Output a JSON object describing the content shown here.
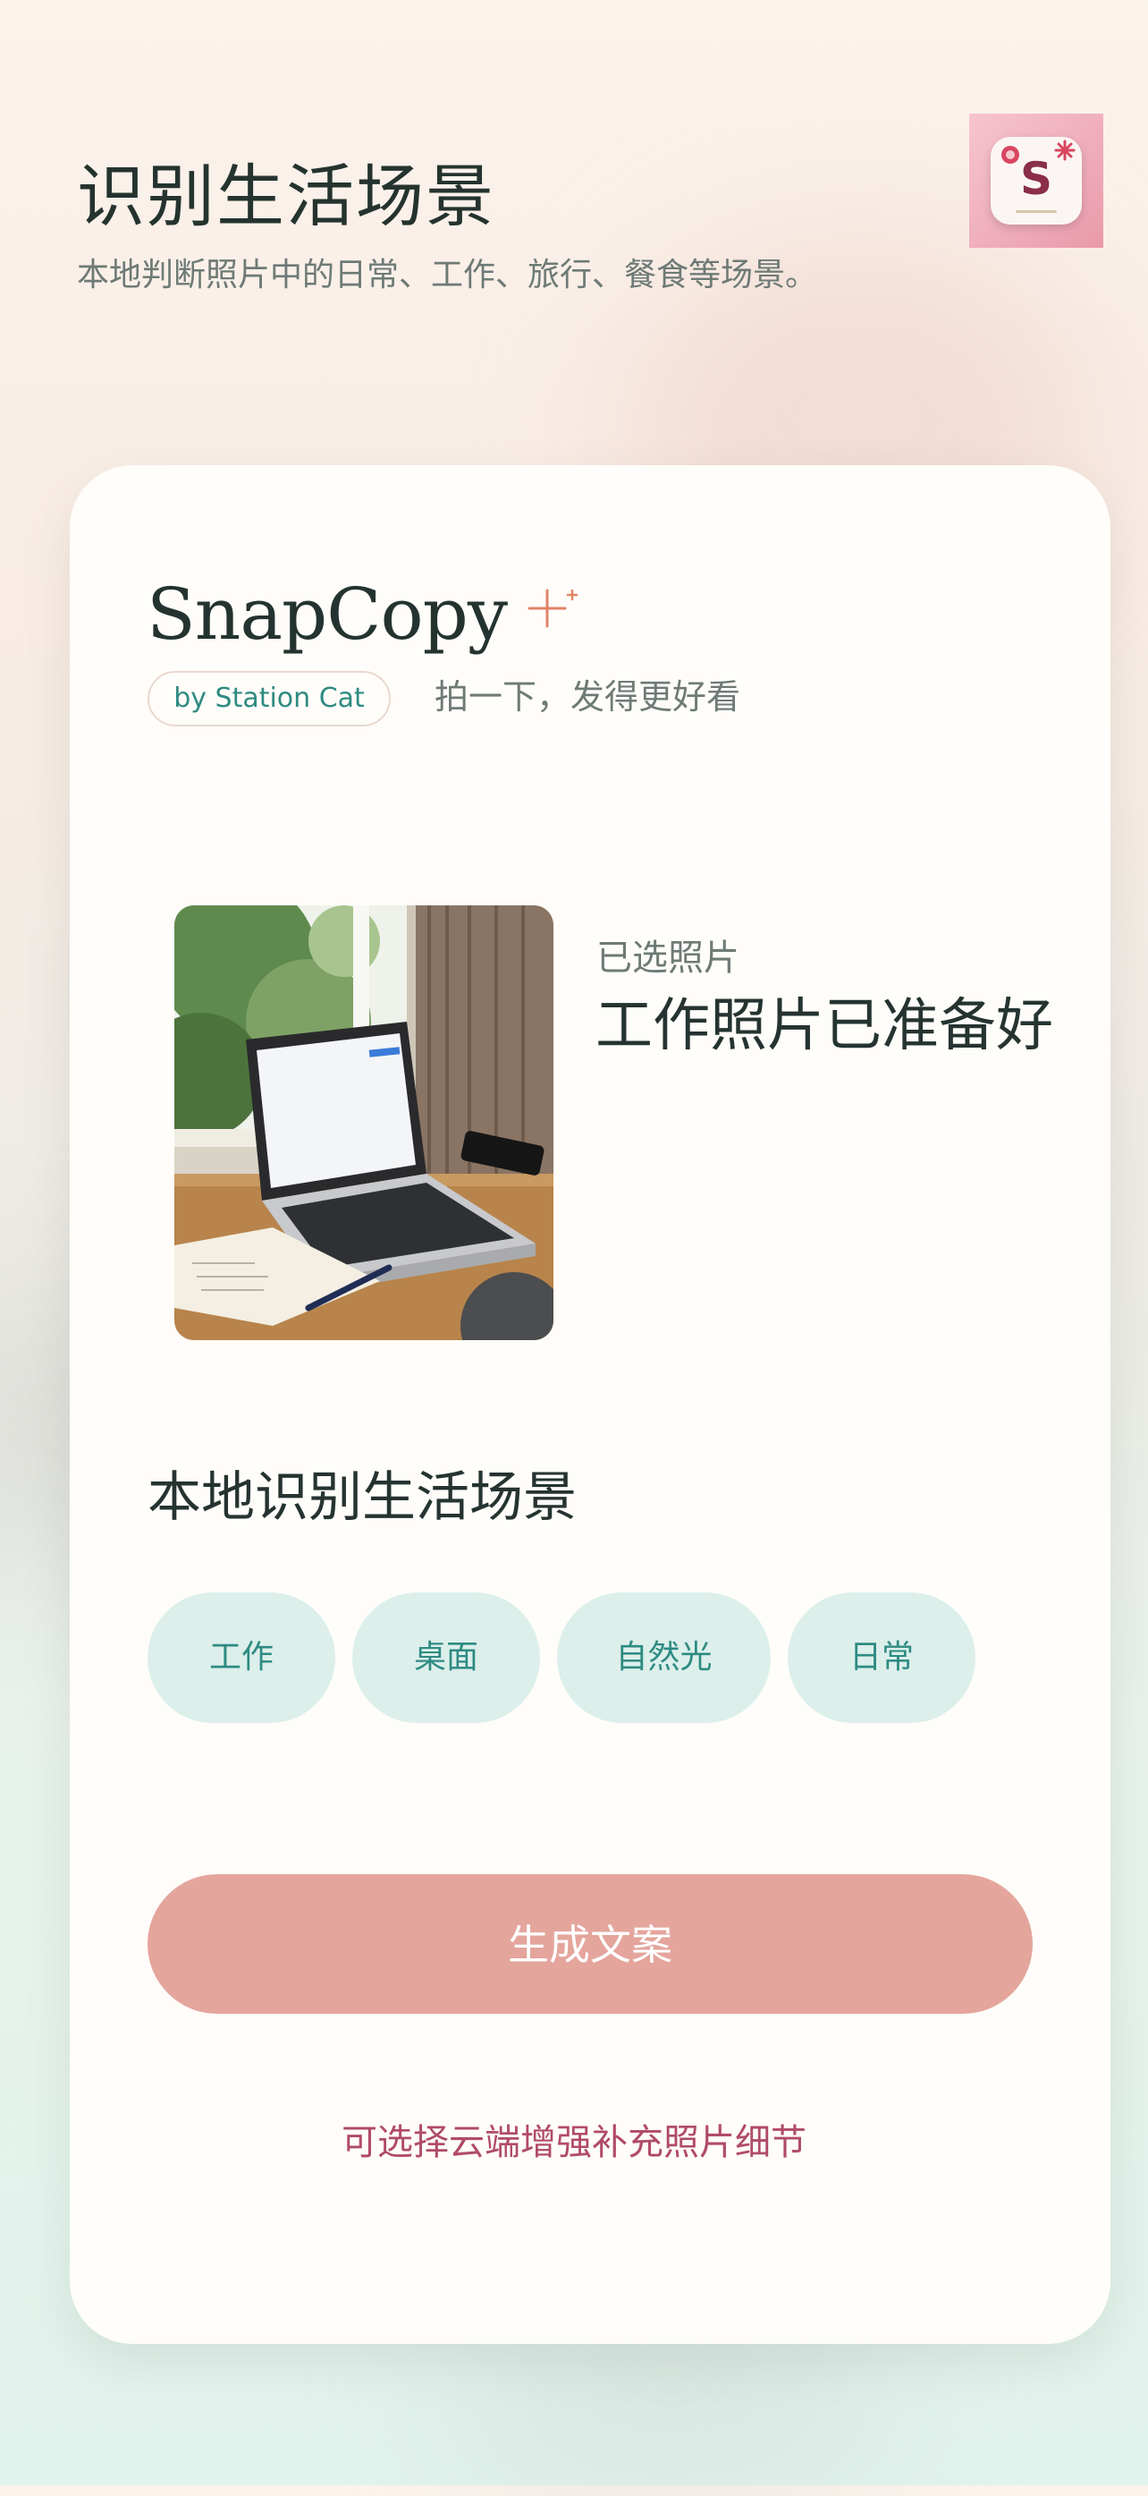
{
  "header": {
    "title": "识别生活场景",
    "subtitle": "本地判断照片中的日常、工作、旅行、餐食等场景。",
    "app_icon_letter": "S"
  },
  "card": {
    "brand": "SnapCopy",
    "byline": "by Station Cat",
    "tagline": "拍一下，发得更好看",
    "selected_photo": {
      "label": "已选照片",
      "title": "工作照片已准备好"
    },
    "scene_section_title": "本地识别生活场景",
    "scene_tags": [
      "工作",
      "桌面",
      "自然光",
      "日常"
    ],
    "generate_button": "生成文案",
    "cloud_enhance_link": "可选择云端增强补充照片细节"
  },
  "colors": {
    "accent_teal": "#2e8b82",
    "chip_bg": "#dcefeb",
    "button_bg": "#e4a59c",
    "link": "#b04b6a"
  }
}
